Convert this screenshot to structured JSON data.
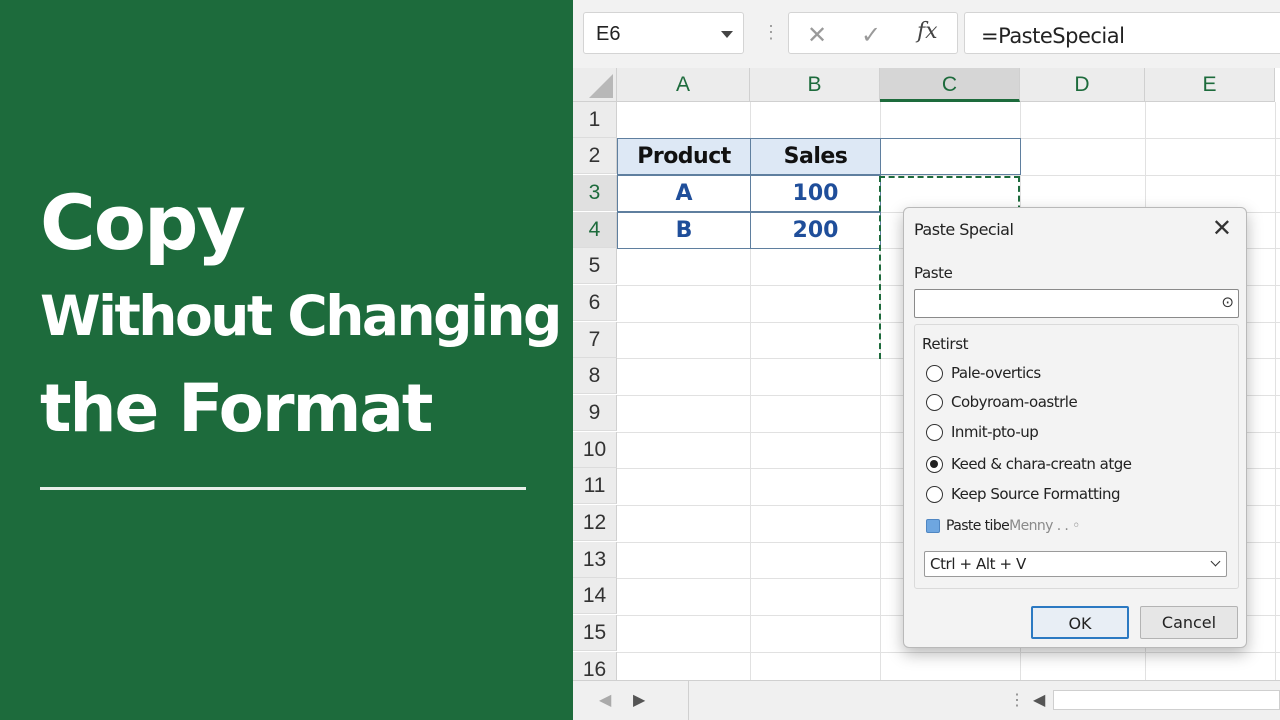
{
  "banner": {
    "title_line1": "Copy",
    "title_line2": "Without Changing",
    "title_line3": "the Format"
  },
  "formula_bar": {
    "name_box": "E6",
    "cancel_glyph": "✕",
    "enter_glyph": "✓",
    "fx_label": "fx",
    "formula": "=PasteSpecial"
  },
  "grid": {
    "columns": [
      "A",
      "B",
      "C",
      "D",
      "E"
    ],
    "selected_column": "C",
    "rows": [
      "1",
      "2",
      "3",
      "4",
      "5",
      "6",
      "7",
      "8",
      "9",
      "10",
      "11",
      "12",
      "13",
      "14",
      "15",
      "16"
    ],
    "selected_rows": [
      "3",
      "4"
    ],
    "table": {
      "headers": [
        "Product",
        "Sales"
      ],
      "rows": [
        [
          "A",
          "100"
        ],
        [
          "B",
          "200"
        ]
      ]
    }
  },
  "dialog": {
    "title": "Paste Special",
    "close_glyph": "✕",
    "paste_label": "Paste",
    "paste_icon": "⊙",
    "group_label": "Retirst",
    "options": [
      {
        "label": "Pale-overtics",
        "selected": false
      },
      {
        "label": "Cobyroam-oastrle",
        "selected": false
      },
      {
        "label": "Inmit-pto-up",
        "selected": false
      },
      {
        "label": "Keed & chara-creatn atge",
        "selected": true
      },
      {
        "label": "Keep Source Formatting",
        "selected": false
      }
    ],
    "checkbox_label": "Paste tibe",
    "checkbox_label_faded": "Menny . . ◦",
    "shortcut": "Ctrl + Alt + V",
    "ok_label": "OK",
    "cancel_label": "Cancel"
  },
  "sheet_bar": {
    "prev_glyph": "◀",
    "next_glyph": "▶",
    "dots": "⋮",
    "scroll_left_glyph": "◀"
  }
}
